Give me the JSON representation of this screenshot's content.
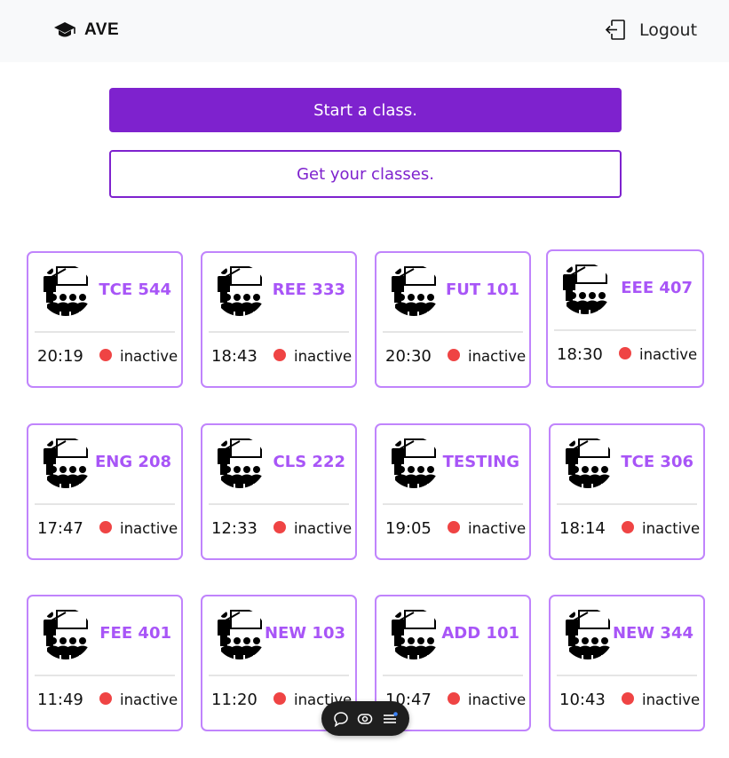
{
  "navbar": {
    "brand": "AVE",
    "brand_icon": "graduation-cap-icon",
    "logout_label": "Logout",
    "logout_icon": "logout-icon"
  },
  "actions": {
    "start_label": "Start a class.",
    "get_label": "Get your classes."
  },
  "colors": {
    "accent": "#7e22ce",
    "card_border": "#c084fc",
    "code_text": "#a855f7",
    "status_dot": "#ef4444"
  },
  "classes": [
    {
      "code": "TCE 544",
      "time": "20:19",
      "status": "inactive"
    },
    {
      "code": "REE 333",
      "time": "18:43",
      "status": "inactive"
    },
    {
      "code": "FUT 101",
      "time": "20:30",
      "status": "inactive"
    },
    {
      "code": "EEE 407",
      "time": "18:30",
      "status": "inactive"
    },
    {
      "code": "ENG 208",
      "time": "17:47",
      "status": "inactive"
    },
    {
      "code": "CLS 222",
      "time": "12:33",
      "status": "inactive"
    },
    {
      "code": "TESTING",
      "time": "19:05",
      "status": "inactive"
    },
    {
      "code": "TCE 306",
      "time": "18:14",
      "status": "inactive"
    },
    {
      "code": "FEE 401",
      "time": "11:49",
      "status": "inactive"
    },
    {
      "code": "NEW 103",
      "time": "11:20",
      "status": "inactive"
    },
    {
      "code": "ADD 101",
      "time": "10:47",
      "status": "inactive"
    },
    {
      "code": "NEW 344",
      "time": "10:43",
      "status": "inactive"
    }
  ],
  "floating_toolbar": {
    "icons": [
      "chat-icon",
      "eye-icon",
      "menu-icon"
    ]
  }
}
